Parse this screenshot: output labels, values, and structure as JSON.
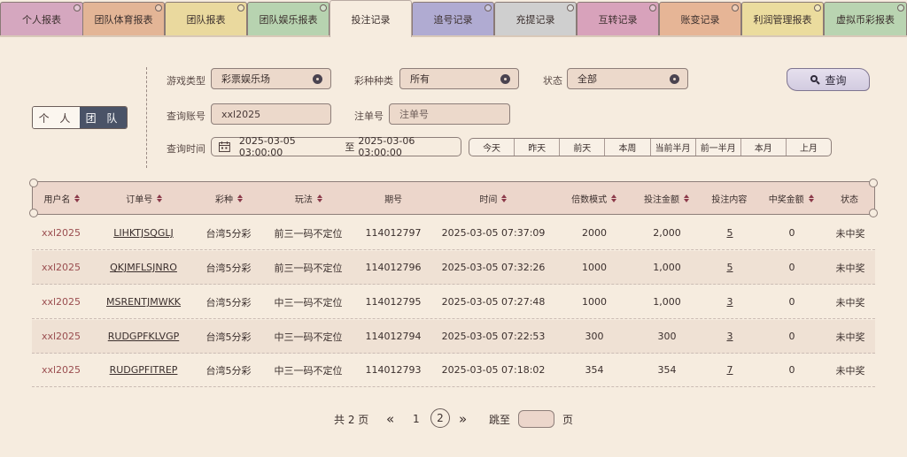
{
  "tabs": [
    {
      "label": "个人报表",
      "color": "#d5a7bf"
    },
    {
      "label": "团队体育报表",
      "color": "#e3b596"
    },
    {
      "label": "团队报表",
      "color": "#ead99e"
    },
    {
      "label": "团队娱乐报表",
      "color": "#b7d3b0"
    },
    {
      "label": "投注记录",
      "color": "#f6ecdf"
    },
    {
      "label": "追号记录",
      "color": "#b0abd2"
    },
    {
      "label": "充提记录",
      "color": "#cfcfcf"
    },
    {
      "label": "互转记录",
      "color": "#d8a2bb"
    },
    {
      "label": "账变记录",
      "color": "#e6b596"
    },
    {
      "label": "利润管理报表",
      "color": "#ebdc9e"
    },
    {
      "label": "虚拟币彩报表",
      "color": "#b9d4b1"
    }
  ],
  "scope_toggle": {
    "personal": "个 人",
    "team": "团 队"
  },
  "filters": {
    "game_type_label": "游戏类型",
    "game_type_value": "彩票娱乐场",
    "lottery_kind_label": "彩种种类",
    "lottery_kind_value": "所有",
    "status_label": "状态",
    "status_value": "全部",
    "account_label": "查询账号",
    "account_value": "xxl2025",
    "order_label": "注单号",
    "order_placeholder": "注单号",
    "time_label": "查询时间",
    "time_start": "2025-03-05 03:00:00",
    "time_sep": "至",
    "time_end": "2025-03-06 03:00:00"
  },
  "query_button": "查询",
  "quick_ranges": [
    "今天",
    "昨天",
    "前天",
    "本周",
    "当前半月",
    "前一半月",
    "本月",
    "上月"
  ],
  "table": {
    "headers": [
      "用户名",
      "订单号",
      "彩种",
      "玩法",
      "期号",
      "时间",
      "倍数模式",
      "投注金额",
      "投注内容",
      "中奖金额",
      "状态"
    ],
    "rows": [
      [
        "xxl2025",
        "LIHKTJSQGLJ",
        "台湾5分彩",
        "前三一码不定位",
        "114012797",
        "2025-03-05 07:37:09",
        "2000",
        "2,000",
        "5",
        "0",
        "未中奖"
      ],
      [
        "xxl2025",
        "QKJMFLSJNRO",
        "台湾5分彩",
        "前三一码不定位",
        "114012796",
        "2025-03-05 07:32:26",
        "1000",
        "1,000",
        "5",
        "0",
        "未中奖"
      ],
      [
        "xxl2025",
        "MSRENTJMWKK",
        "台湾5分彩",
        "中三一码不定位",
        "114012795",
        "2025-03-05 07:27:48",
        "1000",
        "1,000",
        "3",
        "0",
        "未中奖"
      ],
      [
        "xxl2025",
        "RUDGPFKLVGP",
        "台湾5分彩",
        "中三一码不定位",
        "114012794",
        "2025-03-05 07:22:53",
        "300",
        "300",
        "3",
        "0",
        "未中奖"
      ],
      [
        "xxl2025",
        "RUDGPFITREP",
        "台湾5分彩",
        "中三一码不定位",
        "114012793",
        "2025-03-05 07:18:02",
        "354",
        "354",
        "7",
        "0",
        "未中奖"
      ]
    ]
  },
  "pagination": {
    "total": "共 2 页",
    "prev": "«",
    "page1": "1",
    "page2": "2",
    "next": "»",
    "jump_label": "跳至",
    "page_suffix": "页"
  }
}
